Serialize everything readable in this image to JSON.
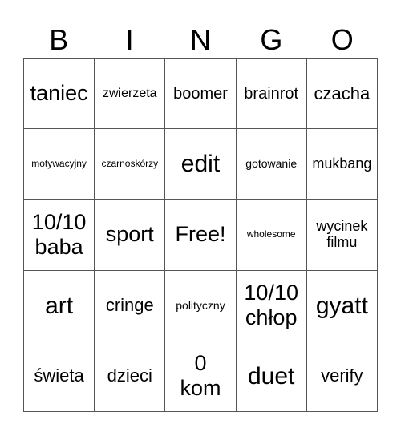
{
  "header": {
    "letters": [
      "B",
      "I",
      "N",
      "G",
      "O"
    ]
  },
  "board": {
    "rows": [
      [
        "taniec",
        "zwierzeta",
        "boomer",
        "brainrot",
        "czacha"
      ],
      [
        "motywacyjny",
        "czarnoskórzy",
        "edit",
        "gotowanie",
        "mukbang"
      ],
      [
        "10/10\nbaba",
        "sport",
        "Free!",
        "wholesome",
        "wycinek\nfilmu"
      ],
      [
        "art",
        "cringe",
        "polityczny",
        "10/10\nchłop",
        "gyatt"
      ],
      [
        "świeta",
        "dzieci",
        "0\nkom",
        "duet",
        "verify"
      ]
    ],
    "free_space": "Free!"
  },
  "colors": {
    "background": "#ffffff",
    "grid_line": "#555555",
    "text": "#000000"
  }
}
